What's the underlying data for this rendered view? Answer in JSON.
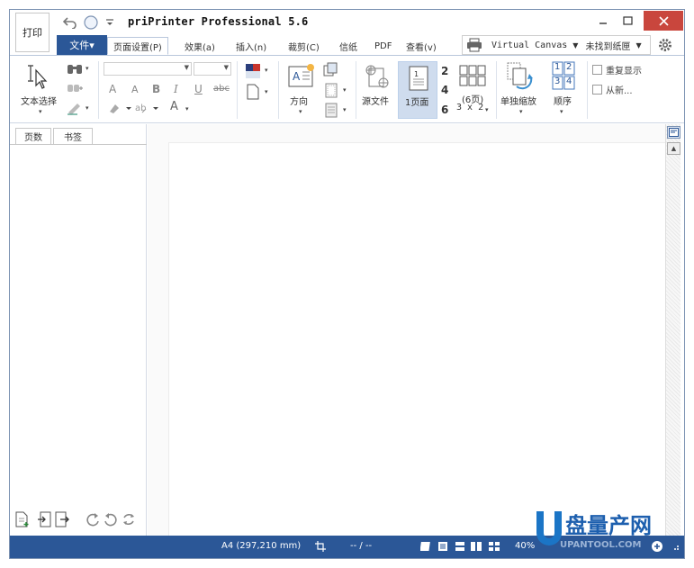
{
  "app": {
    "title": "priPrinter Professional 5.6",
    "print_button_label": "打印"
  },
  "ribbon_tabs": {
    "file": "文件▾",
    "items": [
      "页面设置(P)",
      "效果(a)",
      "插入(n)",
      "裁剪(C)",
      "信纸",
      "PDF",
      "查看(v)"
    ]
  },
  "printer": {
    "name": "Virtual Canvas",
    "paper_tray": "未找到纸匣"
  },
  "ribbon": {
    "text_select": "文本选择",
    "orientation": "方向",
    "source_file": "源文件",
    "one_page": "1页面",
    "pages_per_sheet_numbers": [
      "2",
      "4",
      "6"
    ],
    "six_pages": "(6页)",
    "grid_size": "3 x 2",
    "single_scale": "单独缩放",
    "order": "顺序",
    "order_numbers": [
      "1",
      "2",
      "3",
      "4"
    ],
    "repeat_display": "重复显示",
    "refresh": "从新...",
    "format_letters": [
      "A",
      "A",
      "B",
      "I",
      "U",
      "abc",
      "A"
    ]
  },
  "left_panel": {
    "tabs": [
      "页数",
      "书签"
    ]
  },
  "status_bar": {
    "paper": "A4 (297,210 mm)",
    "page_counter": "-- / --",
    "zoom": "40%"
  },
  "watermark": {
    "text_cn": "盘量产网",
    "text_url": "UPANTOOL.COM"
  },
  "colors": {
    "accent": "#2b5797",
    "close": "#c9463d",
    "selected": "#cfdcee"
  }
}
